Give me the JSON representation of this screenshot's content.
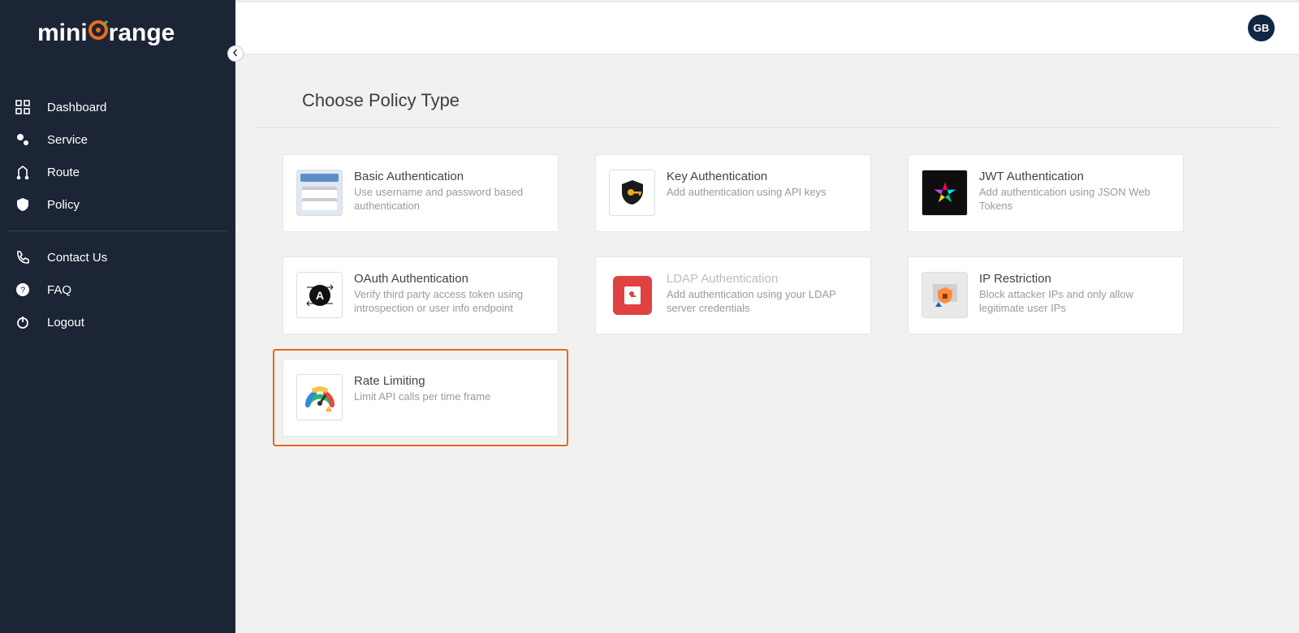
{
  "brand": {
    "pre": "mini",
    "post": "range"
  },
  "sidebar": {
    "items": [
      {
        "label": "Dashboard"
      },
      {
        "label": "Service"
      },
      {
        "label": "Route"
      },
      {
        "label": "Policy"
      }
    ],
    "secondary": [
      {
        "label": "Contact Us"
      },
      {
        "label": "FAQ"
      },
      {
        "label": "Logout"
      }
    ]
  },
  "user": {
    "initials": "GB"
  },
  "page": {
    "title": "Choose Policy Type"
  },
  "policies": [
    {
      "title": "Basic Authentication",
      "desc": "Use username and password based authentication"
    },
    {
      "title": "Key Authentication",
      "desc": "Add authentication using API keys"
    },
    {
      "title": "JWT Authentication",
      "desc": "Add authentication using JSON Web Tokens"
    },
    {
      "title": "OAuth Authentication",
      "desc": "Verify third party access token using introspection or user info endpoint"
    },
    {
      "title": "LDAP Authentication",
      "desc": "Add authentication using your LDAP server credentials"
    },
    {
      "title": "IP Restriction",
      "desc": "Block attacker IPs and only allow legitimate user IPs"
    },
    {
      "title": "Rate Limiting",
      "desc": "Limit API calls per time frame"
    }
  ],
  "colors": {
    "accent": "#ee6c1b",
    "sidebar": "#1c2536",
    "avatar": "#0f2644"
  }
}
